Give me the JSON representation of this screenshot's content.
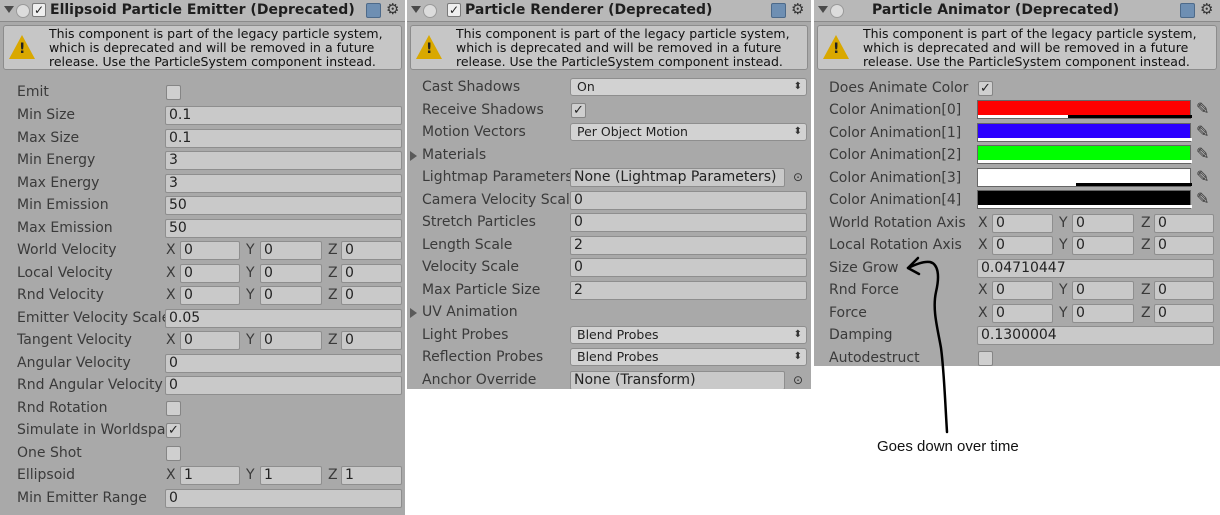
{
  "warning_text": "This component is part of the legacy particle system, which is deprecated and will be removed in a future release. Use the ParticleSystem component instead.",
  "emitter": {
    "title": "Ellipsoid Particle Emitter (Deprecated)",
    "emit_label": "Emit",
    "emit_checked": "",
    "rows": [
      {
        "label": "Min Size",
        "value": "0.1"
      },
      {
        "label": "Max Size",
        "value": "0.1"
      },
      {
        "label": "Min Energy",
        "value": "3"
      },
      {
        "label": "Max Energy",
        "value": "3"
      },
      {
        "label": "Min Emission",
        "value": "50"
      },
      {
        "label": "Max Emission",
        "value": "50"
      }
    ],
    "world_velocity": {
      "label": "World Velocity",
      "x": "0",
      "y": "0",
      "z": "0"
    },
    "local_velocity": {
      "label": "Local Velocity",
      "x": "0",
      "y": "0",
      "z": "0"
    },
    "rnd_velocity": {
      "label": "Rnd Velocity",
      "x": "0",
      "y": "0",
      "z": "0"
    },
    "emitter_velocity_scale": {
      "label": "Emitter Velocity Scale",
      "value": "0.05"
    },
    "tangent_velocity": {
      "label": "Tangent Velocity",
      "x": "0",
      "y": "0",
      "z": "0"
    },
    "angular_velocity": {
      "label": "Angular Velocity",
      "value": "0"
    },
    "rnd_angular_velocity": {
      "label": "Rnd Angular Velocity",
      "value": "0"
    },
    "rnd_rotation": {
      "label": "Rnd Rotation",
      "checked": ""
    },
    "simulate_worldspace": {
      "label": "Simulate in Worldspace",
      "checked": "✓"
    },
    "one_shot": {
      "label": "One Shot",
      "checked": ""
    },
    "ellipsoid": {
      "label": "Ellipsoid",
      "x": "1",
      "y": "1",
      "z": "1"
    },
    "min_emitter_range": {
      "label": "Min Emitter Range",
      "value": "0"
    }
  },
  "renderer": {
    "title": "Particle Renderer (Deprecated)",
    "cast_shadows": {
      "label": "Cast Shadows",
      "value": "On"
    },
    "receive_shadows": {
      "label": "Receive Shadows",
      "checked": "✓"
    },
    "motion_vectors": {
      "label": "Motion Vectors",
      "value": "Per Object Motion"
    },
    "materials": {
      "label": "Materials"
    },
    "lightmap_parameters": {
      "label": "Lightmap Parameters",
      "value": "None (Lightmap Parameters)"
    },
    "camera_velocity_scale": {
      "label": "Camera Velocity Scale",
      "value": "0"
    },
    "stretch_particles": {
      "label": "Stretch Particles",
      "value": "0"
    },
    "length_scale": {
      "label": "Length Scale",
      "value": "2"
    },
    "velocity_scale": {
      "label": "Velocity Scale",
      "value": "0"
    },
    "max_particle_size": {
      "label": "Max Particle Size",
      "value": "2"
    },
    "uv_animation": {
      "label": "UV Animation"
    },
    "light_probes": {
      "label": "Light Probes",
      "value": "Blend Probes"
    },
    "reflection_probes": {
      "label": "Reflection Probes",
      "value": "Blend Probes"
    },
    "anchor_override": {
      "label": "Anchor Override",
      "value": "None (Transform)"
    }
  },
  "animator": {
    "title": "Particle Animator (Deprecated)",
    "does_animate_color": {
      "label": "Does Animate Color",
      "checked": "✓"
    },
    "colors": [
      {
        "label": "Color Animation[0]",
        "color": "#ff0000",
        "alpha": 0.42
      },
      {
        "label": "Color Animation[1]",
        "color": "#2b00ff",
        "alpha": 1.0
      },
      {
        "label": "Color Animation[2]",
        "color": "#00ff00",
        "alpha": 1.0
      },
      {
        "label": "Color Animation[3]",
        "color": "#ffffff",
        "alpha": 0.46
      },
      {
        "label": "Color Animation[4]",
        "color": "#000000",
        "alpha": 1.0
      }
    ],
    "world_rotation_axis": {
      "label": "World Rotation Axis",
      "x": "0",
      "y": "0",
      "z": "0"
    },
    "local_rotation_axis": {
      "label": "Local Rotation Axis",
      "x": "0",
      "y": "0",
      "z": "0"
    },
    "size_grow": {
      "label": "Size Grow",
      "value": "0.04710447"
    },
    "rnd_force": {
      "label": "Rnd Force",
      "x": "0",
      "y": "0",
      "z": "0"
    },
    "force": {
      "label": "Force",
      "x": "0",
      "y": "0",
      "z": "0"
    },
    "damping": {
      "label": "Damping",
      "value": "0.1300004"
    },
    "autodestruct": {
      "label": "Autodestruct",
      "checked": ""
    }
  },
  "annotation": {
    "text": "Goes down over time"
  },
  "axis_letters": {
    "x": "X",
    "y": "Y",
    "z": "Z"
  }
}
